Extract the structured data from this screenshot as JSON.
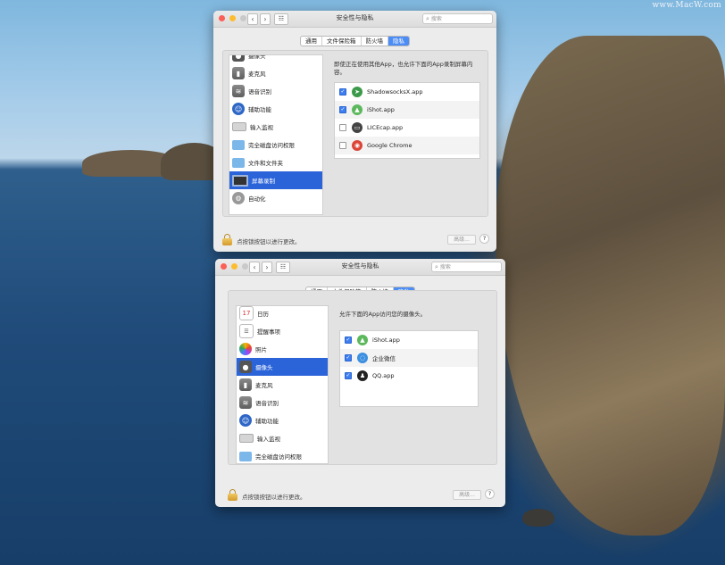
{
  "watermark": "www.MacW.com",
  "window_top": {
    "title": "安全性与隐私",
    "search_placeholder": "搜索",
    "tabs": [
      {
        "label": "通用",
        "active": false
      },
      {
        "label": "文件保险箱",
        "active": false
      },
      {
        "label": "防火墙",
        "active": false
      },
      {
        "label": "隐私",
        "active": true
      }
    ],
    "sidebar": [
      {
        "label": "摄像头",
        "icon": "camera-icon"
      },
      {
        "label": "麦克风",
        "icon": "microphone-icon"
      },
      {
        "label": "语音识别",
        "icon": "speech-recognition-icon"
      },
      {
        "label": "辅助功能",
        "icon": "accessibility-icon"
      },
      {
        "label": "输入监视",
        "icon": "keyboard-icon"
      },
      {
        "label": "完全磁盘访问权限",
        "icon": "folder-icon"
      },
      {
        "label": "文件和文件夹",
        "icon": "folder-icon"
      },
      {
        "label": "屏幕录制",
        "icon": "screen-recording-icon",
        "selected": true
      },
      {
        "label": "自动化",
        "icon": "gear-icon"
      }
    ],
    "description": "即使正在使用其他App，也允许下面的App录制屏幕内容。",
    "apps": [
      {
        "name": "ShadowsocksX.app",
        "checked": true,
        "icon": "paper-plane-icon",
        "color": "#3a9a4a"
      },
      {
        "name": "iShot.app",
        "checked": true,
        "icon": "ishot-icon",
        "color": "#5cb85c"
      },
      {
        "name": "LICEcap.app",
        "checked": false,
        "icon": "licecap-icon",
        "color": "#444444"
      },
      {
        "name": "Google Chrome",
        "checked": false,
        "icon": "chrome-icon",
        "color": "#db4437"
      }
    ],
    "lock_text": "点按锁按钮以进行更改。",
    "advanced_label": "高级...",
    "help_label": "?"
  },
  "window_bottom": {
    "title": "安全性与隐私",
    "search_placeholder": "搜索",
    "tabs": [
      {
        "label": "通用",
        "active": false
      },
      {
        "label": "文件保险箱",
        "active": false
      },
      {
        "label": "防火墙",
        "active": false
      },
      {
        "label": "隐私",
        "active": true
      }
    ],
    "sidebar": [
      {
        "label": "日历",
        "icon": "calendar-icon",
        "glyph": "17"
      },
      {
        "label": "提醒事项",
        "icon": "reminders-icon"
      },
      {
        "label": "照片",
        "icon": "photos-icon"
      },
      {
        "label": "摄像头",
        "icon": "camera-icon",
        "selected": true
      },
      {
        "label": "麦克风",
        "icon": "microphone-icon"
      },
      {
        "label": "语音识别",
        "icon": "speech-recognition-icon"
      },
      {
        "label": "辅助功能",
        "icon": "accessibility-icon"
      },
      {
        "label": "输入监视",
        "icon": "keyboard-icon"
      },
      {
        "label": "完全磁盘访问权限",
        "icon": "folder-icon"
      }
    ],
    "description": "允许下面的App访问您的摄像头。",
    "apps": [
      {
        "name": "iShot.app",
        "checked": true,
        "icon": "ishot-icon",
        "color": "#5cb85c"
      },
      {
        "name": "企业微信",
        "checked": true,
        "icon": "wecom-icon",
        "color": "#3d8fe0"
      },
      {
        "name": "QQ.app",
        "checked": true,
        "icon": "qq-penguin-icon",
        "color": "#222222"
      }
    ],
    "lock_text": "点按锁按钮以进行更改。",
    "advanced_label": "高级...",
    "help_label": "?"
  }
}
